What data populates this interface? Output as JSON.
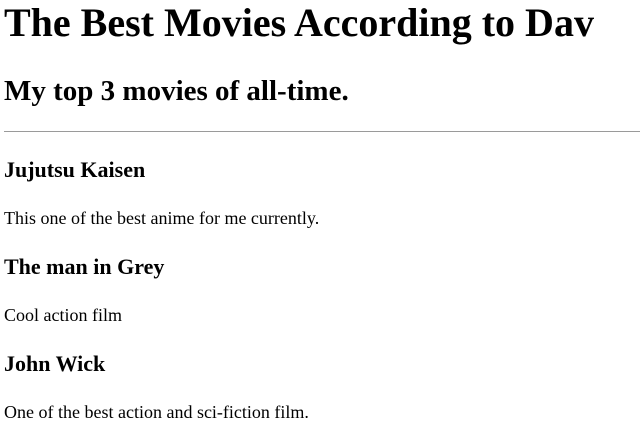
{
  "header": {
    "title": "The Best Movies According to Dav",
    "subtitle": "My top 3 movies of all-time."
  },
  "movies": [
    {
      "title": "Jujutsu Kaisen",
      "description": "This one of the best anime for me currently."
    },
    {
      "title": "The man in Grey",
      "description": "Cool action film"
    },
    {
      "title": "John Wick",
      "description": "One of the best action and sci-fiction film."
    }
  ]
}
